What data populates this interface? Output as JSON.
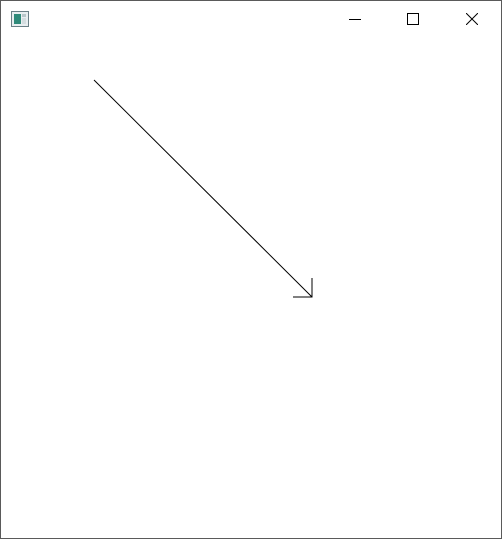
{
  "window": {
    "title": ""
  },
  "titlebar_buttons": {
    "minimize_icon": "minimize-icon",
    "maximize_icon": "maximize-icon",
    "close_icon": "close-icon"
  },
  "drawing": {
    "shape": "arrow",
    "stroke_color": "#000000"
  }
}
